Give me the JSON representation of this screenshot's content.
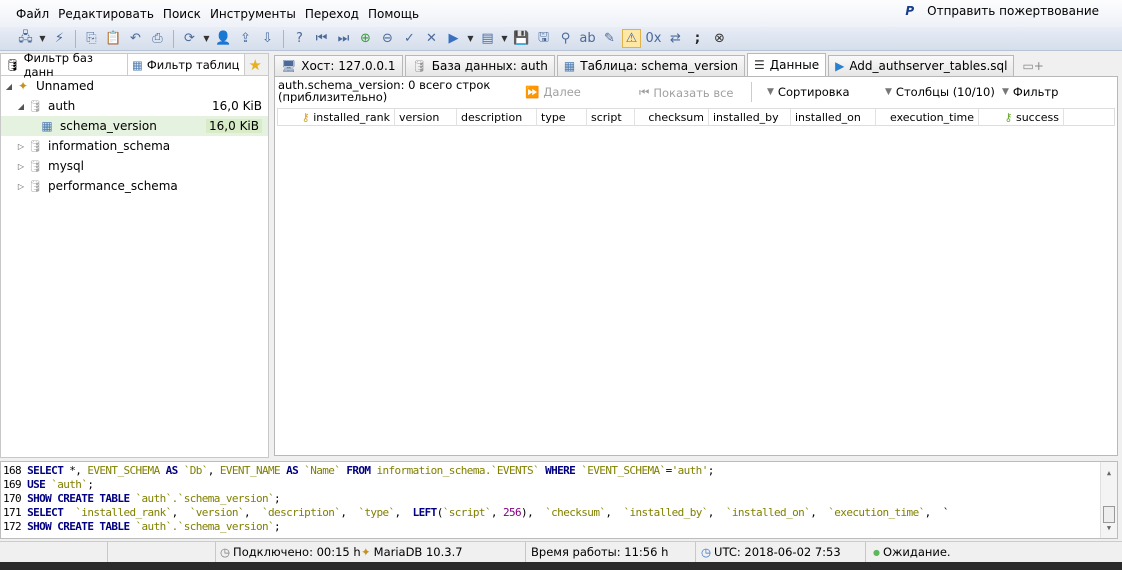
{
  "menu": {
    "items": [
      "Файл",
      "Редактировать",
      "Поиск",
      "Инструменты",
      "Переход",
      "Помощь"
    ],
    "donate": "Отправить пожертвование"
  },
  "toolbar": {
    "icons": [
      "session-manager-icon",
      "dropdown",
      "connect-icon",
      "sep",
      "copy-icon",
      "paste-icon",
      "undo-icon",
      "print-icon",
      "sep",
      "refresh-icon",
      "dropdown",
      "user-manager-icon",
      "export-icon",
      "import-icon",
      "sep",
      "help-icon",
      "first-icon",
      "last-icon",
      "add-row-icon",
      "delete-row-icon",
      "post-icon",
      "cancel-icon",
      "run-icon",
      "dropdown",
      "snippet-icon",
      "dropdown",
      "save-icon",
      "save-as-icon",
      "find-icon",
      "replace-icon",
      "edit-icon",
      "warning-icon",
      "binary-icon",
      "wrap-icon",
      "semicolon-icon",
      "stop-icon"
    ]
  },
  "left": {
    "filter_db": "Фильтр баз данн",
    "filter_tables": "Фильтр таблиц",
    "tree": [
      {
        "label": "Unnamed",
        "level": 0,
        "expanded": true,
        "icon": "server-icon"
      },
      {
        "label": "auth",
        "size": "16,0 KiB",
        "level": 1,
        "expanded": true,
        "icon": "database-icon"
      },
      {
        "label": "schema_version",
        "size": "16,0 KiB",
        "level": 2,
        "selected": true,
        "icon": "table-icon"
      },
      {
        "label": "information_schema",
        "level": 1,
        "icon": "database-icon"
      },
      {
        "label": "mysql",
        "level": 1,
        "icon": "database-icon"
      },
      {
        "label": "performance_schema",
        "level": 1,
        "icon": "database-icon"
      }
    ]
  },
  "tabs": [
    {
      "label": "Хост: 127.0.0.1"
    },
    {
      "label": "База данных: auth"
    },
    {
      "label": "Таблица: schema_version"
    },
    {
      "label": "Данные",
      "active": true
    },
    {
      "label": "Add_authserver_tables.sql"
    }
  ],
  "data": {
    "info": "auth.schema_version: 0 всего строк (приблизительно)",
    "next": "Далее",
    "show_all": "Показать все",
    "sort": "Сортировка",
    "columns": "Столбцы (10/10)",
    "filter": "Фильтр",
    "headers": [
      "installed_rank",
      "version",
      "description",
      "type",
      "script",
      "checksum",
      "installed_by",
      "installed_on",
      "execution_time",
      "success"
    ]
  },
  "log": {
    "colors": {
      "keyword": "#000080",
      "ident": "#808000",
      "text": "#000000",
      "number": "#800080"
    },
    "lines": [
      [
        [
          "168 ",
          "text"
        ],
        [
          "SELECT",
          "keyword"
        ],
        [
          " *, ",
          "text"
        ],
        [
          "EVENT_SCHEMA",
          "ident"
        ],
        [
          " AS ",
          "keyword"
        ],
        [
          "`Db`",
          "ident"
        ],
        [
          ", ",
          "text"
        ],
        [
          "EVENT_NAME",
          "ident"
        ],
        [
          " AS ",
          "keyword"
        ],
        [
          "`Name`",
          "ident"
        ],
        [
          " FROM ",
          "keyword"
        ],
        [
          "information_schema.`EVENTS`",
          "ident"
        ],
        [
          " WHERE ",
          "keyword"
        ],
        [
          "`EVENT_SCHEMA`",
          "ident"
        ],
        [
          "=",
          "text"
        ],
        [
          "'auth'",
          "ident"
        ],
        [
          ";",
          "text"
        ]
      ],
      [
        [
          "169 ",
          "text"
        ],
        [
          "USE",
          "keyword"
        ],
        [
          " ",
          "text"
        ],
        [
          "`auth`",
          "ident"
        ],
        [
          ";",
          "text"
        ]
      ],
      [
        [
          "170 ",
          "text"
        ],
        [
          "SHOW CREATE TABLE",
          "keyword"
        ],
        [
          " ",
          "text"
        ],
        [
          "`auth`.`schema_version`",
          "ident"
        ],
        [
          ";",
          "text"
        ]
      ],
      [
        [
          "171 ",
          "text"
        ],
        [
          "SELECT",
          "keyword"
        ],
        [
          "  ",
          "text"
        ],
        [
          "`installed_rank`",
          "ident"
        ],
        [
          ",  ",
          "text"
        ],
        [
          "`version`",
          "ident"
        ],
        [
          ",  ",
          "text"
        ],
        [
          "`description`",
          "ident"
        ],
        [
          ",  ",
          "text"
        ],
        [
          "`type`",
          "ident"
        ],
        [
          ",  ",
          "text"
        ],
        [
          "LEFT",
          "keyword"
        ],
        [
          "(",
          "text"
        ],
        [
          "`script`",
          "ident"
        ],
        [
          ", ",
          "text"
        ],
        [
          "256",
          "number"
        ],
        [
          "),  ",
          "text"
        ],
        [
          "`checksum`",
          "ident"
        ],
        [
          ",  ",
          "text"
        ],
        [
          "`installed_by`",
          "ident"
        ],
        [
          ",  ",
          "text"
        ],
        [
          "`installed_on`",
          "ident"
        ],
        [
          ",  ",
          "text"
        ],
        [
          "`execution_time`",
          "ident"
        ],
        [
          ",  `",
          "text"
        ]
      ],
      [
        [
          "172 ",
          "text"
        ],
        [
          "SHOW CREATE TABLE",
          "keyword"
        ],
        [
          " ",
          "text"
        ],
        [
          "`auth`.`schema_version`",
          "ident"
        ],
        [
          ";",
          "text"
        ]
      ]
    ]
  },
  "status": {
    "connected": "Подключено: 00:15 h",
    "server": "MariaDB 10.3.7",
    "uptime": "Время работы: 11:56 h",
    "utc": "UTC: 2018-06-02 7:53",
    "state": "Ожидание."
  }
}
